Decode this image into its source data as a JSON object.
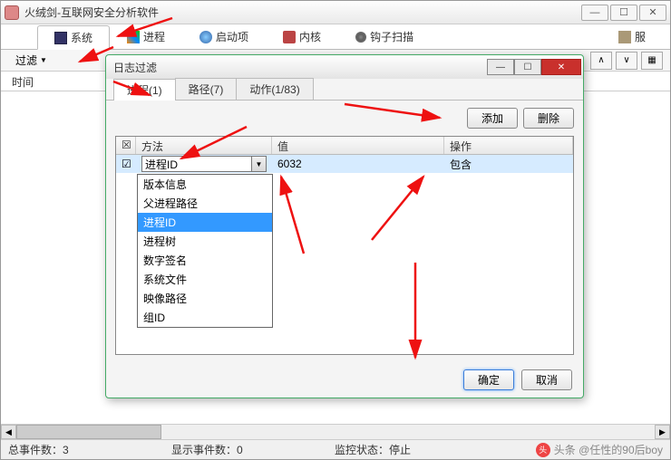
{
  "window": {
    "title": "火绒剑-互联网安全分析软件",
    "min": "—",
    "max": "☐",
    "close": "✕"
  },
  "tabs": {
    "system": "系统",
    "process": "进程",
    "startup": "启动项",
    "kernel": "内核",
    "hooks": "钩子扫描",
    "service": "服"
  },
  "filter": {
    "label": "过滤",
    "nav_up": "∧",
    "nav_down": "∨",
    "view": "▦"
  },
  "columns": {
    "time": "时间"
  },
  "status": {
    "total": "总事件数：3",
    "shown": "显示事件数：0",
    "monitor": "监控状态：停止"
  },
  "watermark": "头条 @任性的90后boy",
  "dialog": {
    "title": "日志过滤",
    "win": {
      "min": "—",
      "max": "☐",
      "close": "✕"
    },
    "tabs": {
      "proc": "进程(1)",
      "path": "路径(7)",
      "action": "动作(1/83)"
    },
    "buttons": {
      "add": "添加",
      "delete": "删除",
      "ok": "确定",
      "cancel": "取消"
    },
    "grid": {
      "head": {
        "chk": "☒",
        "method": "方法",
        "value": "值",
        "op": "操作"
      },
      "row": {
        "chk": "☑",
        "method": "进程ID",
        "value": "6032",
        "op": "包含"
      }
    },
    "dropdown": [
      "版本信息",
      "父进程路径",
      "进程ID",
      "进程树",
      "数字签名",
      "系统文件",
      "映像路径",
      "组ID"
    ],
    "dropdown_selected": 2
  }
}
